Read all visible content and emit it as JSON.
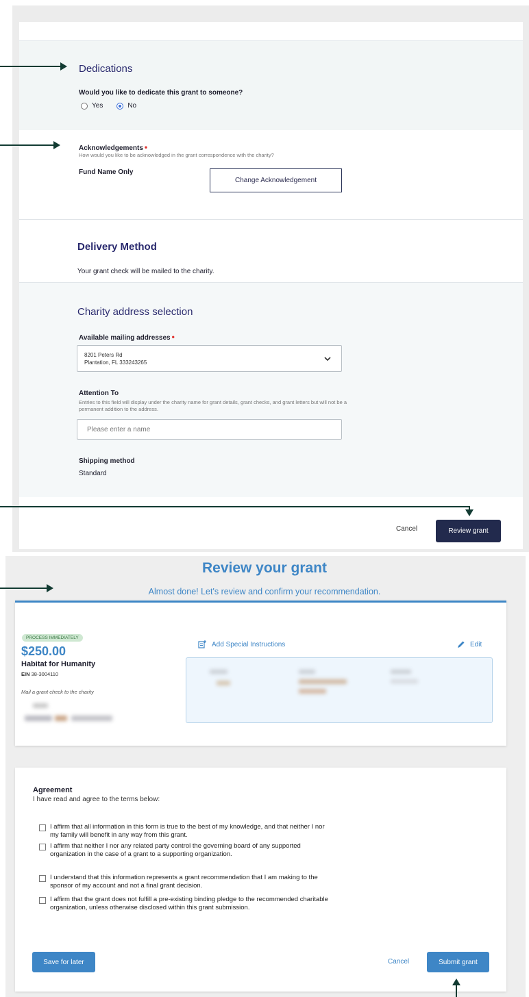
{
  "dedications": {
    "title": "Dedications",
    "question": "Would you like to dedicate this grant to someone?",
    "option_yes": "Yes",
    "option_no": "No",
    "selected": "No"
  },
  "acknowledgements": {
    "title": "Acknowledgements",
    "help": "How would you like to be acknowledged in the grant correspondence with the charity?",
    "value": "Fund Name Only",
    "change_button": "Change Acknowledgement"
  },
  "delivery": {
    "title": "Delivery Method",
    "text": "Your grant check will be mailed to the charity."
  },
  "address_selection": {
    "title": "Charity address selection",
    "label": "Available mailing addresses",
    "address_line1": "8201 Peters Rd",
    "address_line2": "Plantation, FL 333243265",
    "attention_label": "Attention To",
    "attention_help": "Entries to this field will display under the charity name for grant details, grant checks, and grant letters but will not be a permanent addition to the address.",
    "attention_placeholder": "Please enter a name",
    "shipping_label": "Shipping method",
    "shipping_value": "Standard"
  },
  "top_actions": {
    "cancel": "Cancel",
    "review": "Review grant"
  },
  "review": {
    "title": "Review your grant",
    "subtitle": "Almost done! Let's review and confirm your recommendation.",
    "badge": "PROCESS IMMEDIATELY",
    "amount": "$250.00",
    "charity": "Habitat for Humanity",
    "ein_label": "EIN",
    "ein_value": "38-3004110",
    "mail_note": "Mail a grant check to the charity",
    "special_instructions": "Add Special Instructions",
    "edit": "Edit"
  },
  "agreement": {
    "title": "Agreement",
    "subtitle": "I have read and agree to the terms below:",
    "items": [
      "I affirm that all information in this form is true to the best of my knowledge, and that neither I nor my family will benefit in any way from this grant.",
      "I affirm that neither I nor any related party control the governing board of any supported organization in the case of a grant to a supporting organization.",
      "I understand that this information represents a grant recommendation that I am making to the sponsor of my account and not a final grant decision.",
      "I affirm that the grant does not fulfill a pre-existing binding pledge to the recommended charitable organization, unless otherwise disclosed within this grant submission."
    ]
  },
  "bottom_actions": {
    "save": "Save for later",
    "cancel": "Cancel",
    "submit": "Submit grant"
  },
  "colors": {
    "brand_blue": "#3e86c6",
    "navy": "#222a4d",
    "arrow": "#123b32",
    "required": "#e0302c"
  }
}
